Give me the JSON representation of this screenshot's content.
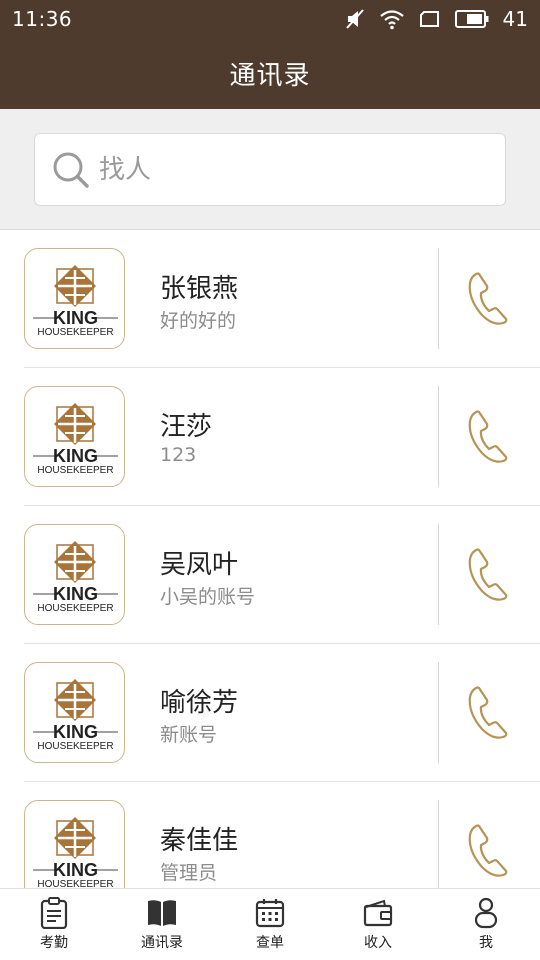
{
  "status_bar": {
    "time": "11:36",
    "battery_level": "41",
    "icons": [
      "mute-icon",
      "wifi-icon",
      "screen-icon",
      "battery-icon"
    ]
  },
  "header": {
    "title": "通讯录"
  },
  "search": {
    "placeholder": "找人",
    "value": "",
    "icon": "search-icon"
  },
  "avatar_logo": {
    "line1": "KING",
    "line2": "HOUSEKEEPER"
  },
  "contacts": [
    {
      "name": "张银燕",
      "note": "好的好的"
    },
    {
      "name": "汪莎",
      "note": "123"
    },
    {
      "name": "吴凤叶",
      "note": "小吴的账号"
    },
    {
      "name": "喻徐芳",
      "note": "新账号"
    },
    {
      "name": "秦佳佳",
      "note": "管理员"
    }
  ],
  "tabs": [
    {
      "label": "考勤",
      "icon": "clipboard-icon"
    },
    {
      "label": "通讯录",
      "icon": "book-icon",
      "active": true
    },
    {
      "label": "查单",
      "icon": "calendar-icon"
    },
    {
      "label": "收入",
      "icon": "wallet-icon"
    },
    {
      "label": "我",
      "icon": "person-icon"
    }
  ],
  "colors": {
    "header_bg": "#4e3b2d",
    "accent_gold": "#b59455",
    "logo_brown": "#a9743a"
  }
}
